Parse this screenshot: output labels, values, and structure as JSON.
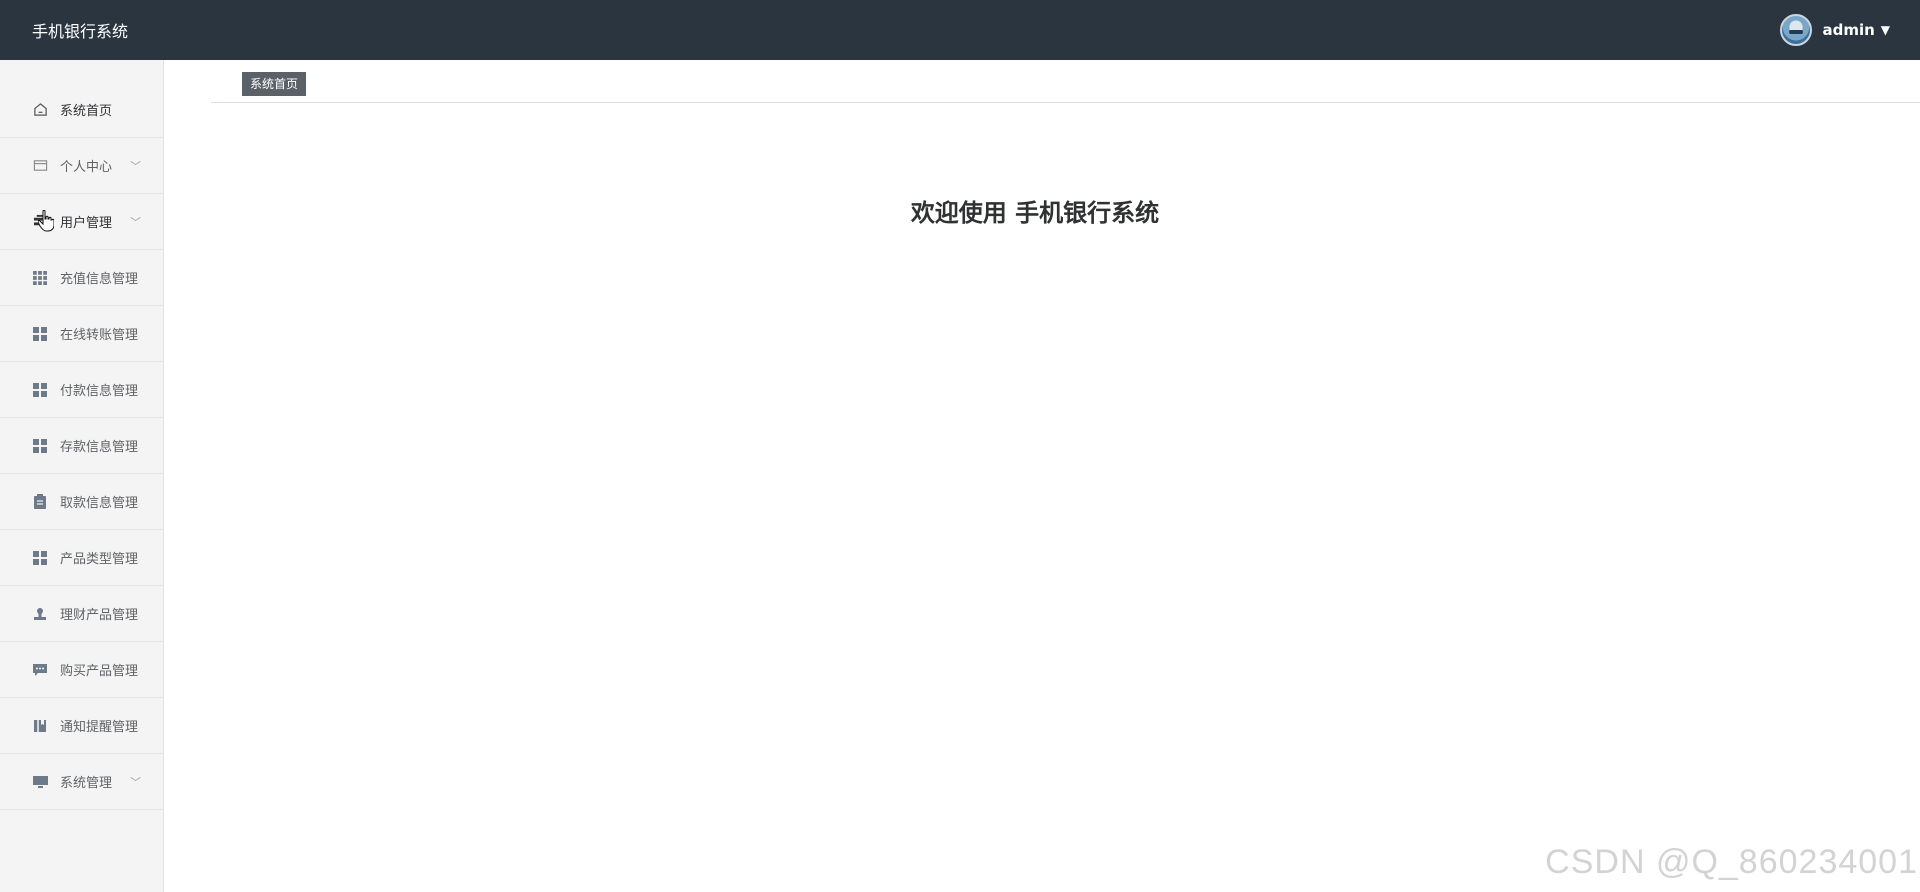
{
  "header": {
    "app_title": "手机银行系统",
    "user": {
      "name": "admin"
    }
  },
  "sidebar": {
    "items": [
      {
        "label": "系统首页",
        "icon": "home-icon",
        "expandable": false
      },
      {
        "label": "个人中心",
        "icon": "card-icon",
        "expandable": true
      },
      {
        "label": "用户管理",
        "icon": "users-icon",
        "expandable": true
      },
      {
        "label": "充值信息管理",
        "icon": "grid9-icon",
        "expandable": false
      },
      {
        "label": "在线转账管理",
        "icon": "grid4-icon",
        "expandable": false
      },
      {
        "label": "付款信息管理",
        "icon": "grid4-icon",
        "expandable": false
      },
      {
        "label": "存款信息管理",
        "icon": "grid4-icon",
        "expandable": false
      },
      {
        "label": "取款信息管理",
        "icon": "clipboard-icon",
        "expandable": false
      },
      {
        "label": "产品类型管理",
        "icon": "grid4-icon",
        "expandable": false
      },
      {
        "label": "理财产品管理",
        "icon": "stamp-icon",
        "expandable": false
      },
      {
        "label": "购买产品管理",
        "icon": "chat-icon",
        "expandable": false
      },
      {
        "label": "通知提醒管理",
        "icon": "book-icon",
        "expandable": false
      },
      {
        "label": "系统管理",
        "icon": "monitor-icon",
        "expandable": true
      }
    ]
  },
  "tabs": [
    {
      "label": "系统首页"
    }
  ],
  "main": {
    "welcome": "欢迎使用 手机银行系统"
  },
  "watermark": "CSDN @Q_860234001",
  "colors": {
    "topbar": "#2b3540",
    "sidebar": "#f4f4f5",
    "tab_active": "#5b6168"
  }
}
